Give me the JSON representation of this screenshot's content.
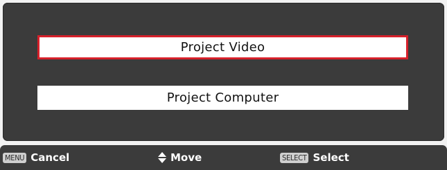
{
  "menu": {
    "options": [
      {
        "label": "Project Video",
        "selected": true
      },
      {
        "label": "Project Computer",
        "selected": false
      }
    ],
    "highlight_color": "#d6202a"
  },
  "footer": {
    "cancel": {
      "key": "MENU",
      "label": "Cancel"
    },
    "move": {
      "icon": "up-down-arrows-icon",
      "label": "Move"
    },
    "select": {
      "key": "SELECT",
      "label": "Select"
    }
  }
}
